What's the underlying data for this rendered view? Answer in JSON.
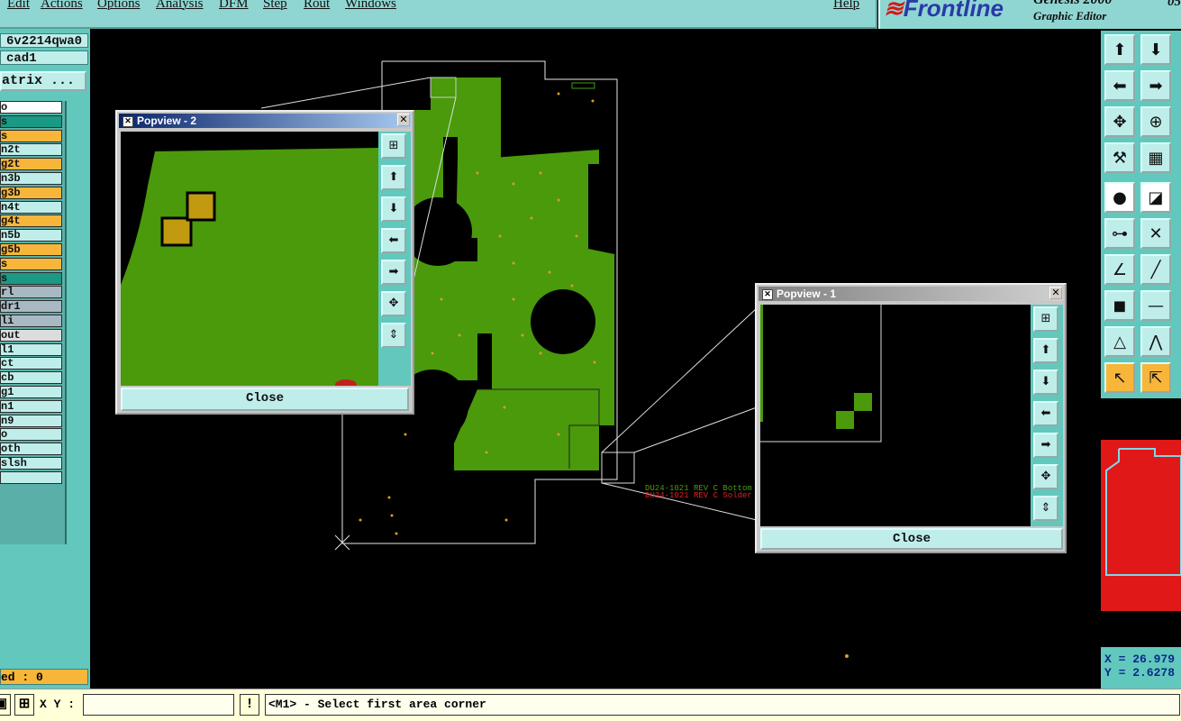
{
  "menu": {
    "items": [
      "Edit",
      "Actions",
      "Options",
      "Analysis",
      "DFM",
      "Step",
      "Rout",
      "Windows"
    ],
    "help": "Help"
  },
  "brand": {
    "logo": "Frontline",
    "product": "Genesis 2000",
    "subtitle": "Graphic Editor",
    "date": "05"
  },
  "left_panel": {
    "job": "6v2214qwa0",
    "step": "cad1",
    "matrix_button": "atrix ...",
    "layers": [
      {
        "label": "o",
        "color": "white"
      },
      {
        "label": "s",
        "color": "teal"
      },
      {
        "label": "s",
        "color": "orange"
      },
      {
        "label": "n2t",
        "color": "cyan"
      },
      {
        "label": "g2t",
        "color": "orange"
      },
      {
        "label": "n3b",
        "color": "cyan"
      },
      {
        "label": "g3b",
        "color": "orange"
      },
      {
        "label": "n4t",
        "color": "cyan"
      },
      {
        "label": "g4t",
        "color": "orange"
      },
      {
        "label": "n5b",
        "color": "cyan"
      },
      {
        "label": "g5b",
        "color": "orange"
      },
      {
        "label": "s",
        "color": "orange"
      },
      {
        "label": "s",
        "color": "teal"
      },
      {
        "label": "rl",
        "color": "grey"
      },
      {
        "label": "dr1",
        "color": "grey"
      },
      {
        "label": "li",
        "color": "grey"
      },
      {
        "label": "out",
        "color": "light"
      },
      {
        "label": "l1",
        "color": "cyan"
      },
      {
        "label": "ct",
        "color": "cyan"
      },
      {
        "label": "cb",
        "color": "cyan"
      },
      {
        "label": "g1",
        "color": "cyan"
      },
      {
        "label": "n1",
        "color": "cyan"
      },
      {
        "label": "n9",
        "color": "cyan"
      },
      {
        "label": "o",
        "color": "cyan"
      },
      {
        "label": "oth",
        "color": "cyan"
      },
      {
        "label": "slsh",
        "color": "cyan"
      },
      {
        "label": "",
        "color": "cyan"
      }
    ],
    "selected": "ed : 0"
  },
  "status_bar": {
    "xy_label": "X Y :",
    "xy_value": "",
    "message": "<M1> - Select first area corner",
    "bang": "!"
  },
  "popview2": {
    "title": "Popview - 2",
    "close": "Close"
  },
  "popview1": {
    "title": "Popview - 1",
    "close": "Close"
  },
  "board_texts": {
    "line1": "DU24-1021 REV C  Bottom",
    "line2": "DU24-1021 REV C  Solder"
  },
  "coords": {
    "x": "X = 26.979",
    "y": "Y = 2.6278"
  },
  "colors": {
    "panel": "#62c8bd",
    "board_green": "#4a9a0c",
    "highlight": "#f7b63a"
  }
}
